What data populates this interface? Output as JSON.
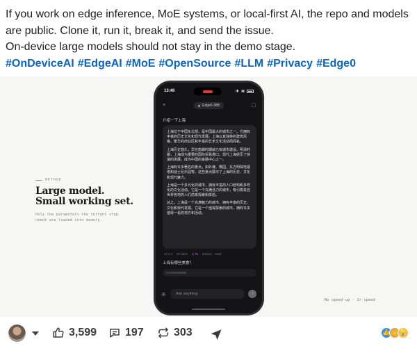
{
  "post": {
    "lines": [
      "If you work on edge inference, MoE systems, or local-first AI, the repo and models",
      "are public. Clone it, run it, break it, and send the issue.",
      "On-device large models should not stay in the demo stage."
    ],
    "hashtags": [
      "#OnDeviceAI",
      "#EdgeAI",
      "#MoE",
      "#OpenSource",
      "#LLM",
      "#Privacy",
      "#Edge0"
    ]
  },
  "media": {
    "eyebrow": "METHOD",
    "headline_line1": "Large model.",
    "headline_line2": "Small working set.",
    "sub_line1": "Only the parameters the current step",
    "sub_line2": "needs are loaded into memory.",
    "caption_right": "No speed-up · 1× speed",
    "phone": {
      "time": "13:46",
      "model_name": "Edge0-38B",
      "user_message": "介绍一下上海",
      "reply_paragraphs": [
        "上海位于中国东北部，是中国最大的城市之一。它拥有丰富的历史文化和现代发展。上海以其独特的建筑风格、繁华的商业区和丰富的艺术文化活动而闻名。",
        "上海历史悠久，早在唐朝时期就已有城市建设。明清时期，上海成为重要的国际贸易港口。现代上海经历了快速的发展，成为中国的金融中心之一。",
        "上海有许多著名的景点，如外滩、豫园、东方明珠电视塔和迪士尼乐园等。这些景点展示了上海的历史、文化和现代魅力。",
        "上海是一个多元化的城市，拥有丰富的人口结构和多样化的文化活动。它是一个充满活力的城市，吸引着来自世界各地的人们前来探索和体验。",
        "总之，上海是一个充满魅力的城市，拥有丰富的历史、文化和现代发展。它是一个值得探索的城市，拥有许多值得一看的地方和活动。"
      ],
      "meta_left": "47.6 s",
      "meta_mid": "51 tok/s",
      "meta_hl": "1.76",
      "meta_right": "tok/sec · read",
      "user_message2": "上海有哪些美食？",
      "input_placeholder": "Ask anything"
    }
  },
  "actions": {
    "likes": "3,599",
    "comments": "197",
    "reposts": "303"
  },
  "colors": {
    "link": "#0a66c2",
    "phone_bg": "#141416",
    "accent_purple": "#b07de0"
  }
}
